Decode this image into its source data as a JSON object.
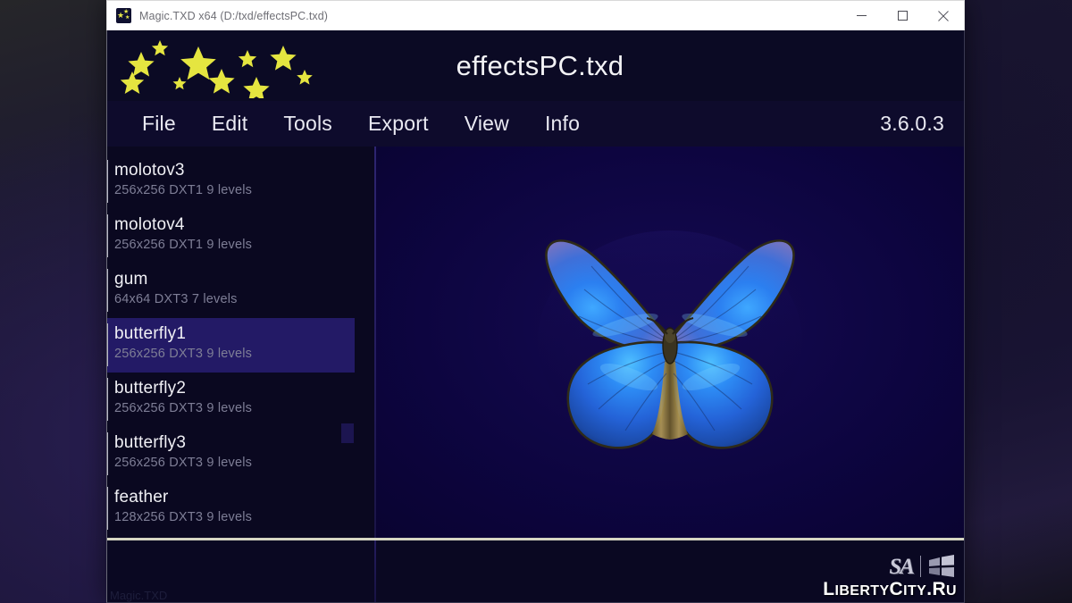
{
  "window": {
    "title": "Magic.TXD x64 (D:/txd/effectsPC.txd)",
    "icon_name": "stars-app-icon",
    "controls": {
      "minimize": "minimize-icon",
      "maximize": "maximize-icon",
      "close": "close-icon"
    }
  },
  "header": {
    "logo_name": "stars-logo",
    "app_title": "effectsPC.txd"
  },
  "menu": {
    "items": [
      {
        "label": "File"
      },
      {
        "label": "Edit"
      },
      {
        "label": "Tools"
      },
      {
        "label": "Export"
      },
      {
        "label": "View"
      },
      {
        "label": "Info"
      }
    ],
    "version": "3.6.0.3"
  },
  "texture_list": {
    "items": [
      {
        "name": "molotov3",
        "meta": "256x256 DXT1 9 levels",
        "selected": false
      },
      {
        "name": "molotov4",
        "meta": "256x256 DXT1 9 levels",
        "selected": false
      },
      {
        "name": "gum",
        "meta": "64x64 DXT3 7 levels",
        "selected": false
      },
      {
        "name": "butterfly1",
        "meta": "256x256 DXT3 9 levels",
        "selected": true
      },
      {
        "name": "butterfly2",
        "meta": "256x256 DXT3 9 levels",
        "selected": false
      },
      {
        "name": "butterfly3",
        "meta": "256x256 DXT3 9 levels",
        "selected": false
      },
      {
        "name": "feather",
        "meta": "128x256 DXT3 9 levels",
        "selected": false
      }
    ]
  },
  "viewer": {
    "image_name": "blue-morpho-butterfly-texture"
  },
  "status_bar": {
    "text": "Magic.TXD"
  },
  "watermark": {
    "sa_label": "SA",
    "flag_name": "windows-flag-icon",
    "site_parts": [
      {
        "t": "L",
        "cap": true
      },
      {
        "t": "IBERTY",
        "cap": false
      },
      {
        "t": "C",
        "cap": true
      },
      {
        "t": "ITY",
        "cap": false
      },
      {
        "t": ".R",
        "cap": true
      },
      {
        "t": "U",
        "cap": false
      }
    ],
    "site": "LibertyCity.Ru"
  },
  "colors": {
    "accent_selection": "#231a66",
    "header_bg": "#0b0a24",
    "menu_bg": "#0e0b2c",
    "viewer_bg": "#0a0233",
    "star_yellow": "#e8e84a",
    "separator": "#d6d6c2"
  }
}
